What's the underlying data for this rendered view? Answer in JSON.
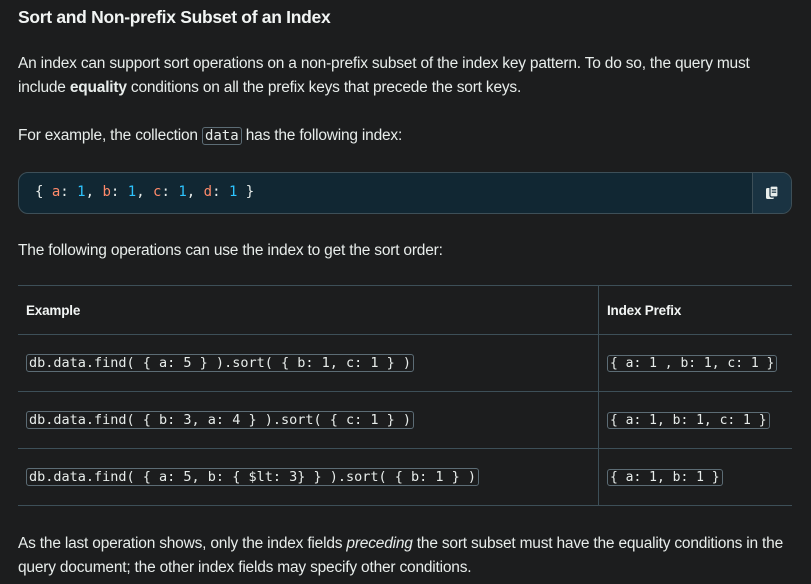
{
  "heading": "Sort and Non-prefix Subset of an Index",
  "intro": {
    "before": "An index can support sort operations on a non-prefix subset of the index key pattern. To do so, the query must include ",
    "bold": "equality",
    "after": " conditions on all the prefix keys that precede the sort keys."
  },
  "example": {
    "before": "For example, the collection ",
    "code": "data",
    "after": " has the following index:"
  },
  "index_code": {
    "open": "{ ",
    "pairs": [
      {
        "key": "a",
        "val": "1"
      },
      {
        "key": "b",
        "val": "1"
      },
      {
        "key": "c",
        "val": "1"
      },
      {
        "key": "d",
        "val": "1"
      }
    ],
    "close": " }"
  },
  "following": "The following operations can use the index to get the sort order:",
  "table": {
    "headers": [
      "Example",
      "Index Prefix"
    ],
    "rows": [
      {
        "example": "db.data.find( { a: 5 } ).sort( { b: 1, c: 1 } )",
        "prefix": "{ a: 1 , b: 1, c: 1 }"
      },
      {
        "example": "db.data.find( { b: 3, a: 4 } ).sort( { c: 1 } )",
        "prefix": "{ a: 1, b: 1, c: 1 }"
      },
      {
        "example": "db.data.find( { a: 5, b: { $lt: 3} } ).sort( { b: 1 } )",
        "prefix": "{ a: 1, b: 1 }"
      }
    ]
  },
  "closing": {
    "before": "As the last operation shows, only the index fields ",
    "italic": "preceding",
    "after": " the sort subset must have the equality conditions in the query document; the other index fields may specify other conditions."
  },
  "icons": {
    "copy": "copy-icon"
  },
  "colors": {
    "key": "#ff8a6a",
    "number": "#2dc4ff",
    "code_bg": "#112733"
  }
}
